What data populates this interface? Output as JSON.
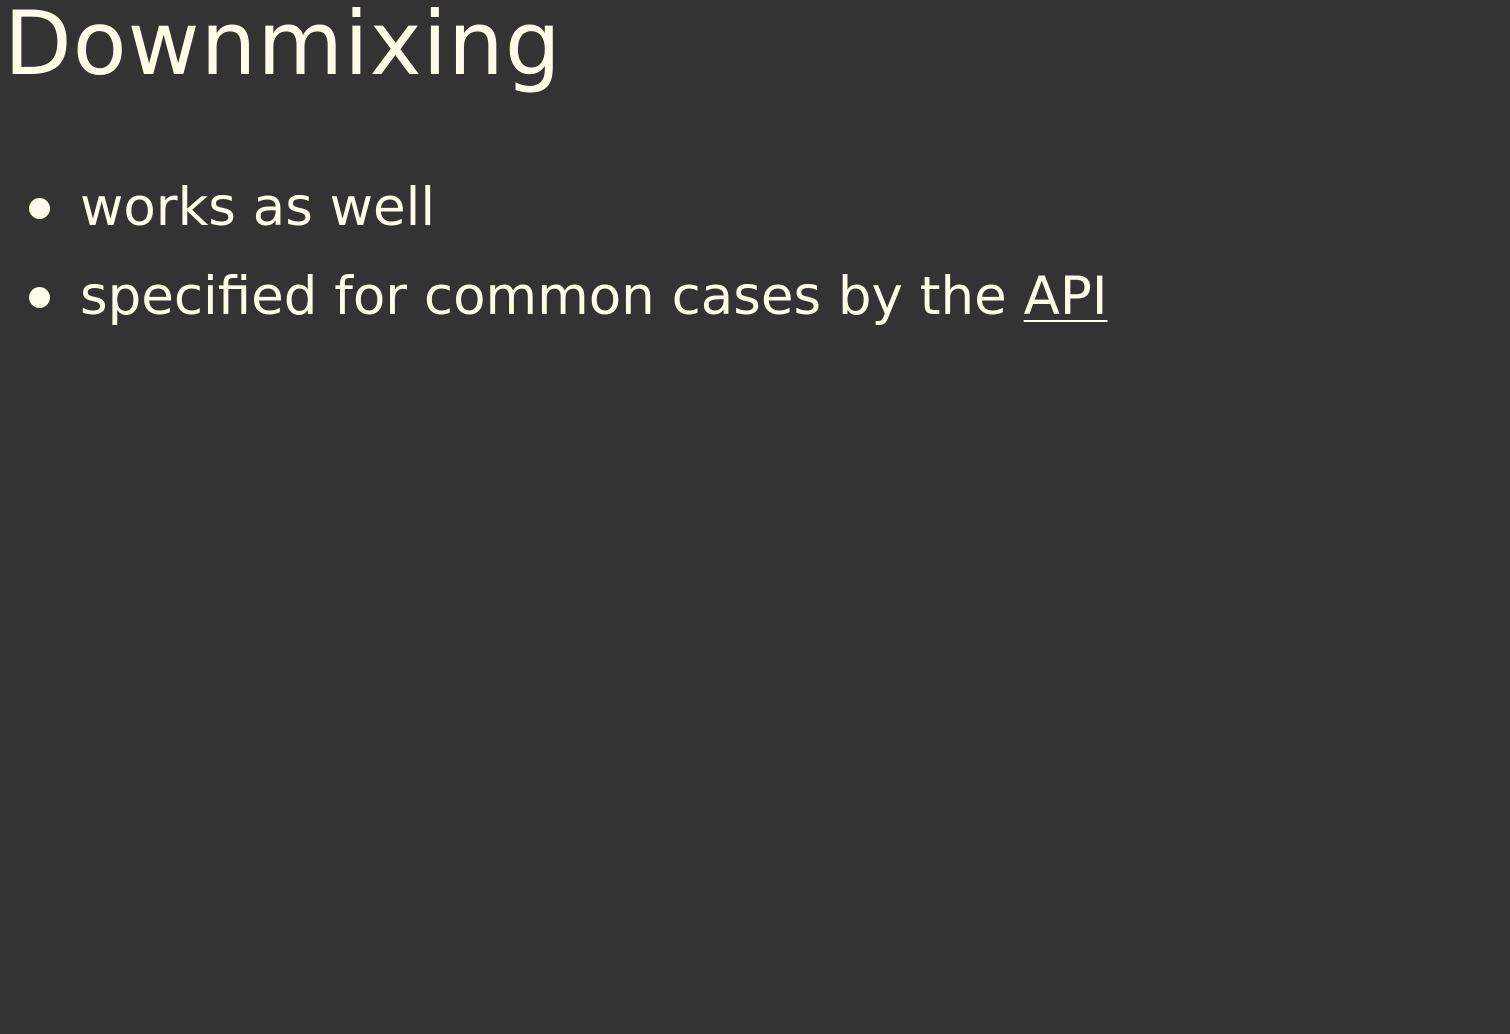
{
  "slide": {
    "title": "Downmixing",
    "bullets": [
      {
        "text": "works as well"
      },
      {
        "text": "specified for common cases by the ",
        "link_text": "API"
      }
    ]
  },
  "colors": {
    "background": "#333333",
    "text": "#fefee8"
  }
}
